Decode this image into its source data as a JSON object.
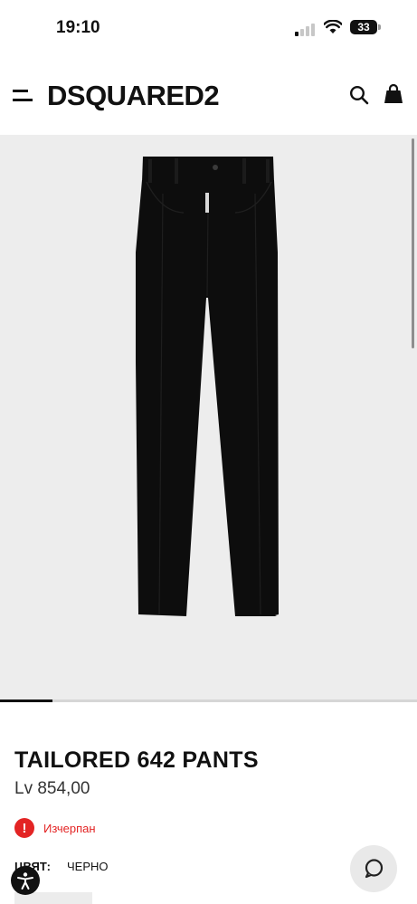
{
  "status_bar": {
    "time": "19:10",
    "battery": "33"
  },
  "header": {
    "brand": "DSQUARED2"
  },
  "product": {
    "name": "TAILORED 642 PANTS",
    "price": "Lv 854,00",
    "availability": "Изчерпан",
    "color_label": "ЦВЯТ:",
    "color_value": "ЧЕРНО"
  },
  "gallery": {
    "progress": 0.125,
    "background": "#ededed",
    "garment_color": "#0d0d0d"
  },
  "colors": {
    "sold_out": "#e32424",
    "text": "#111111"
  },
  "icons": [
    "menu-icon",
    "search-icon",
    "bag-icon",
    "sold-out-icon",
    "accessibility-icon",
    "chat-icon"
  ]
}
